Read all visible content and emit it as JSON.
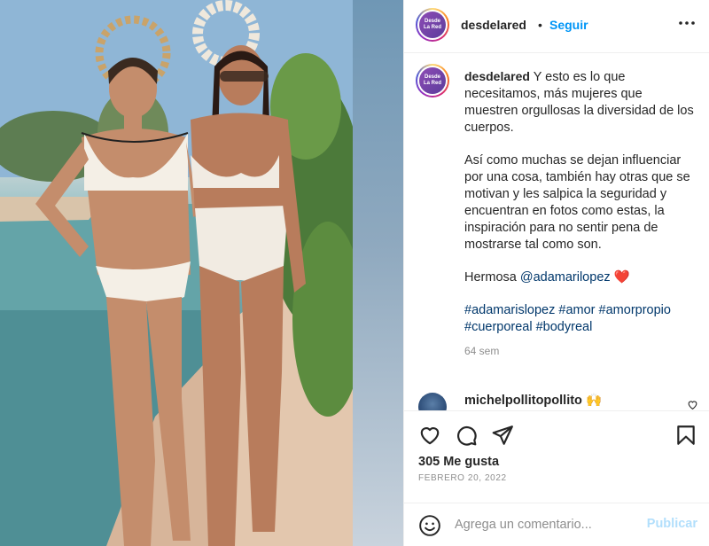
{
  "post": {
    "username": "desdelared",
    "separator": "•",
    "follow_label": "Seguir",
    "more_icon": "ellipsis-icon",
    "avatar_logo_top": "Desde",
    "avatar_logo_bottom": "La Red"
  },
  "caption": {
    "username": "desdelared",
    "paragraph1": "Y esto es lo que necesitamos, más mujeres que muestren orgullosas la diversidad de los cuerpos.",
    "paragraph2": "Así como muchas se dejan influenciar por una cosa, también hay otras que se motivan y les salpica la seguridad y encuentran en fotos como estas, la inspiración para no sentir pena de mostrarse tal como son.",
    "paragraph3_text": "Hermosa ",
    "paragraph3_mention": "@adamarilopez",
    "paragraph3_emoji": "❤️",
    "hashtags": [
      "#adamarislopez",
      "#amor",
      "#amorpropio",
      "#cuerporeal",
      "#bodyreal"
    ],
    "time_ago": "64 sem"
  },
  "comments": [
    {
      "username": "michelpollitopollito",
      "emoji": "🙌"
    }
  ],
  "actions": {
    "icons": [
      "heart-icon",
      "comment-icon",
      "share-icon",
      "bookmark-icon"
    ],
    "likes": "305 Me gusta",
    "date": "FEBRERO 20, 2022"
  },
  "add_comment": {
    "placeholder": "Agrega un comentario...",
    "publish_label": "Publicar"
  },
  "colors": {
    "accent": "#0095f6",
    "link": "#00376b",
    "muted": "#8e8e8e",
    "publish_disabled": "#b2dffc",
    "heart": "#ed1c24"
  }
}
